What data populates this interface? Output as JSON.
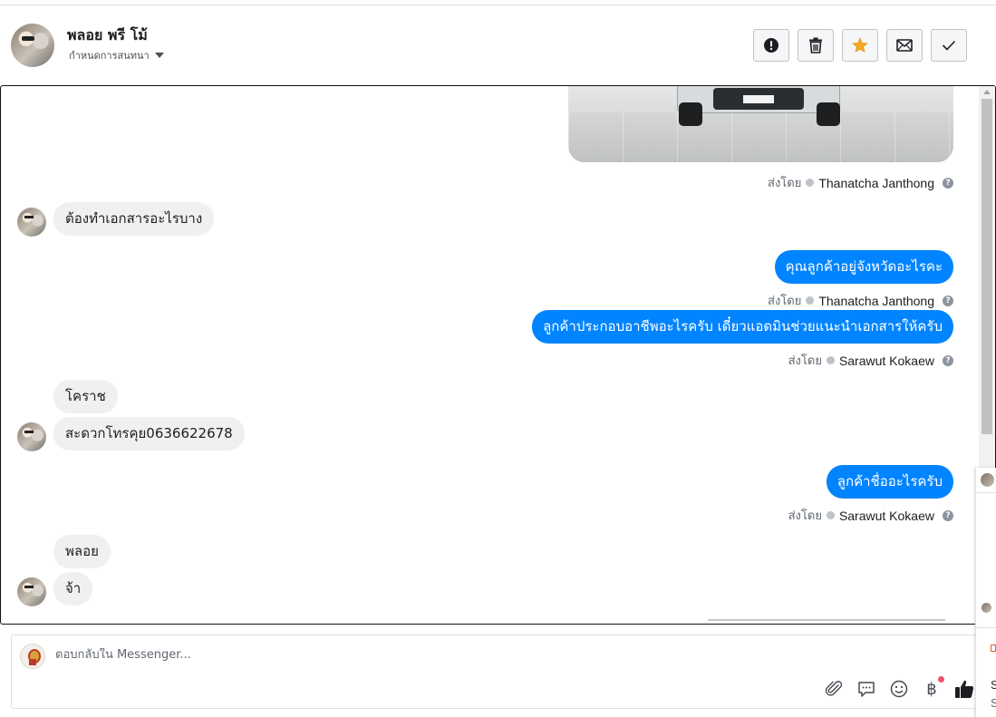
{
  "header": {
    "contact_name": "พลอย พรี โม้",
    "assign_label": "กำหนดการสนทนา",
    "actions": [
      {
        "name": "spam-button",
        "icon": "exclamation-icon"
      },
      {
        "name": "delete-button",
        "icon": "trash-icon"
      },
      {
        "name": "star-button",
        "icon": "star-icon"
      },
      {
        "name": "mark-unread-button",
        "icon": "envelope-icon"
      },
      {
        "name": "mark-done-button",
        "icon": "checkmark-icon"
      }
    ]
  },
  "thread": {
    "sent_by_label": "ส่งโดย",
    "messages": [
      {
        "direction": "out",
        "type": "image",
        "sender": "Thanatcha Janthong"
      },
      {
        "direction": "in",
        "text": "ต้องทำเอกสารอะไรบาง"
      },
      {
        "direction": "out",
        "text": "คุณลูกค้าอยู่จังหวัดอะไรคะ",
        "sender": "Thanatcha Janthong"
      },
      {
        "direction": "out",
        "text": "ลูกค้าประกอบอาชีพอะไรครับ เดี๋ยวแอดมินช่วยแนะนำเอกสารให้ครับ",
        "sender": "Sarawut Kokaew"
      },
      {
        "direction": "in",
        "text": "โคราช"
      },
      {
        "direction": "in",
        "text": "สะดวกโทรคุย0636622678"
      },
      {
        "direction": "out",
        "text": "ลูกค้าชื่ออะไรครับ",
        "sender": "Sarawut Kokaew"
      },
      {
        "direction": "in",
        "text": "พลอย"
      },
      {
        "direction": "in",
        "text": "จ้า"
      }
    ]
  },
  "composer": {
    "placeholder": "ตอบกลับใน Messenger...",
    "currency_symbol": "฿"
  },
  "side_panel": {
    "text1": "S",
    "text2": "S"
  },
  "colors": {
    "outgoing_bubble": "#0084ff",
    "incoming_bubble": "#f0f0f0",
    "star": "#f5a623",
    "notification_dot": "#f25268"
  }
}
